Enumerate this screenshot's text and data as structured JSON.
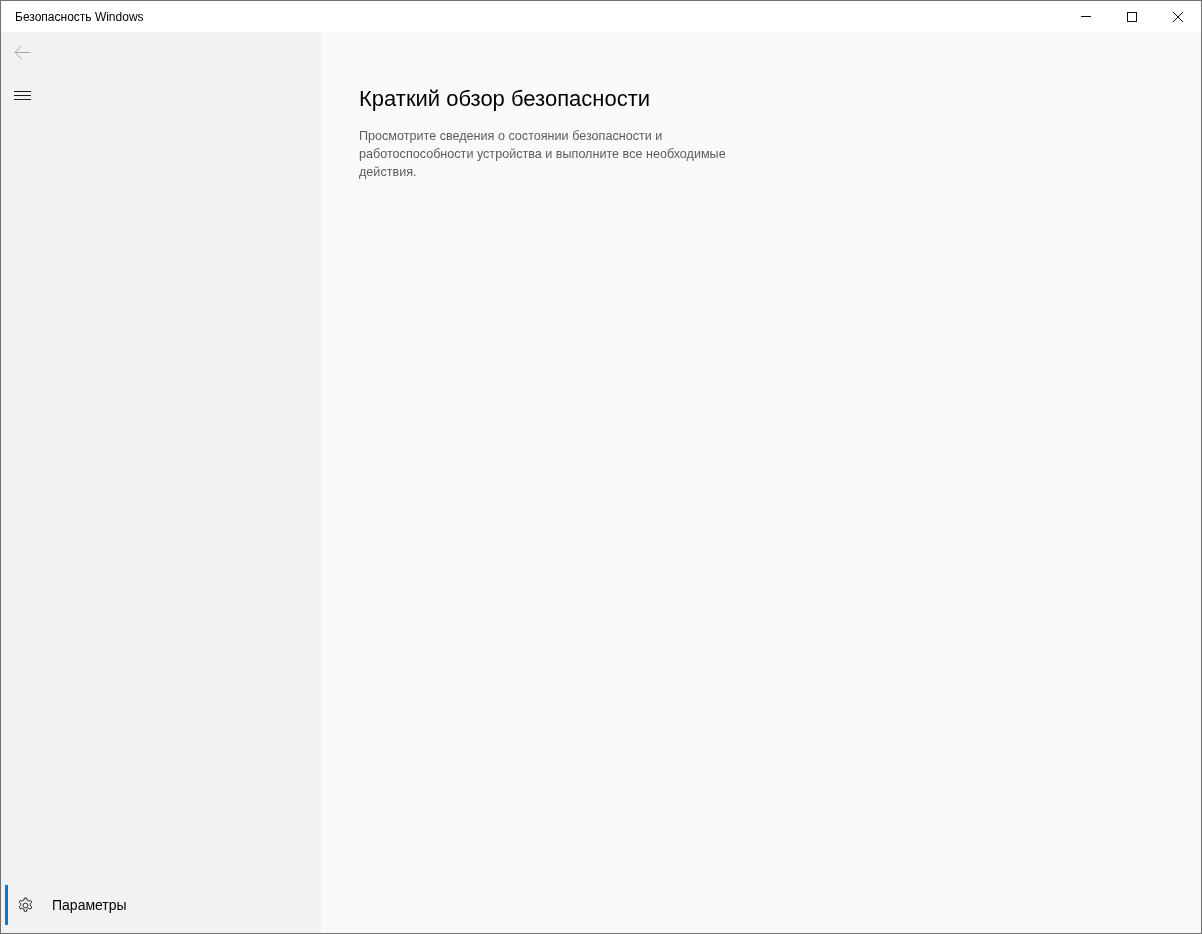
{
  "window": {
    "title": "Безопасность Windows"
  },
  "navigation": {
    "back": {
      "disabled": true
    }
  },
  "sidebar": {
    "footer_items": [
      {
        "label": "Параметры",
        "selected": true
      }
    ]
  },
  "main": {
    "title": "Краткий обзор безопасности",
    "description": "Просмотрите сведения о состоянии безопасности и работоспособности устройства и выполните все необходимые действия."
  }
}
